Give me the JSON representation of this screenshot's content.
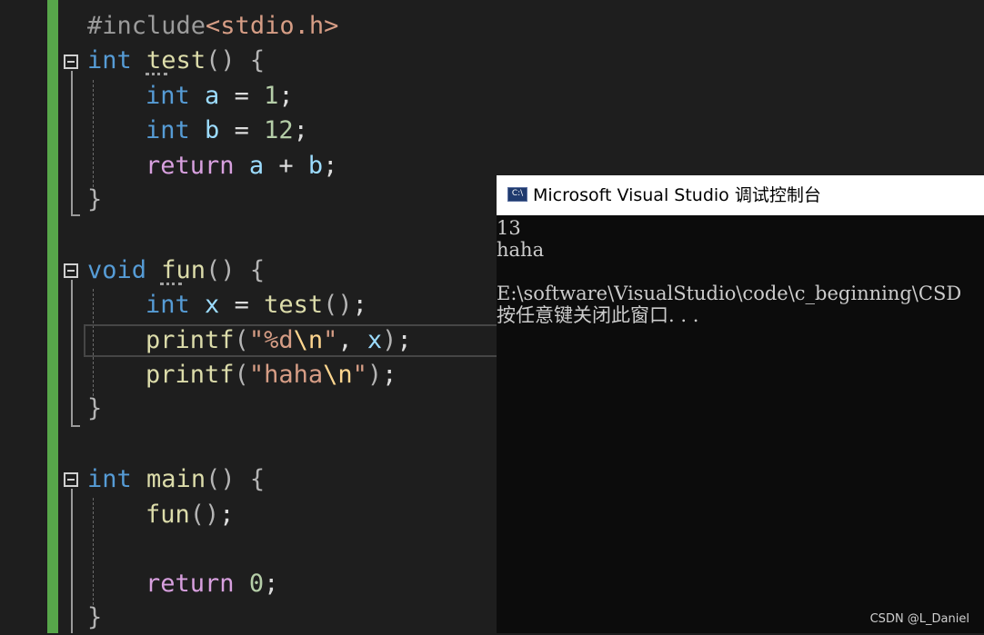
{
  "code": {
    "include_directive": "#include",
    "include_file": "<stdio.h>",
    "kw_int": "int",
    "kw_void": "void",
    "kw_return": "return",
    "fn_test": "test",
    "fn_fun": "fun",
    "fn_main": "main",
    "fn_printf": "printf",
    "var_a": "a",
    "var_b": "b",
    "var_x": "x",
    "num_1": "1",
    "num_12": "12",
    "num_0": "0",
    "str_open": "\"",
    "fmt_d": "%d",
    "esc_n": "\\n",
    "str_haha": "haha",
    "op_assign": "=",
    "op_plus": "+",
    "sig_empty": "()",
    "brace_open": "{",
    "brace_close": "}",
    "semicolon": ";",
    "paren_open": "(",
    "paren_close": ")",
    "comma": ","
  },
  "console": {
    "title": "Microsoft Visual Studio 调试控制台",
    "icon_label": "C:\\",
    "lines": [
      "13",
      "haha",
      "",
      "E:\\software\\VisualStudio\\code\\c_beginning\\CSD",
      "按任意键关闭此窗口. . ."
    ]
  },
  "watermark": "CSDN @L_Daniel",
  "colors": {
    "keyword": "#569cd6",
    "control": "#d8a0df",
    "function": "#dcdcaa",
    "variable": "#9cdcfe",
    "number": "#b5cea8",
    "string": "#d69d85",
    "change_bar": "#57a64a"
  }
}
